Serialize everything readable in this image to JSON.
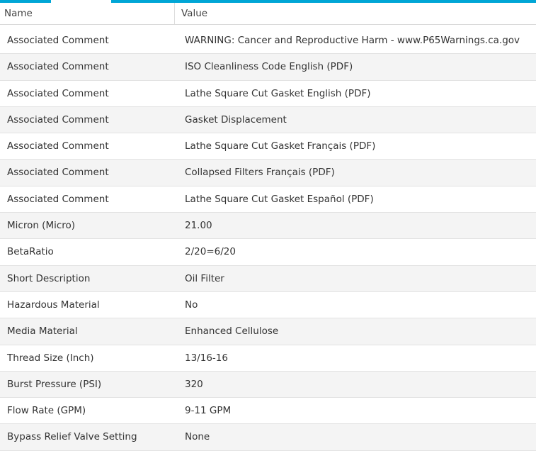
{
  "table": {
    "headers": {
      "name": "Name",
      "value": "Value"
    },
    "rows": [
      {
        "name": "Associated Comment",
        "value": "WARNING: Cancer and Reproductive Harm - www.P65Warnings.ca.gov"
      },
      {
        "name": "Associated Comment",
        "value": "ISO Cleanliness Code English (PDF)"
      },
      {
        "name": "Associated Comment",
        "value": "Lathe Square Cut Gasket English (PDF)"
      },
      {
        "name": "Associated Comment",
        "value": "Gasket Displacement"
      },
      {
        "name": "Associated Comment",
        "value": "Lathe Square Cut Gasket Français (PDF)"
      },
      {
        "name": "Associated Comment",
        "value": "Collapsed Filters Français (PDF)"
      },
      {
        "name": "Associated Comment",
        "value": "Lathe Square Cut Gasket Español (PDF)"
      },
      {
        "name": "Micron (Micro)",
        "value": "21.00"
      },
      {
        "name": "BetaRatio",
        "value": "2/20=6/20"
      },
      {
        "name": "Short Description",
        "value": "Oil Filter"
      },
      {
        "name": "Hazardous Material",
        "value": "No"
      },
      {
        "name": "Media Material",
        "value": "Enhanced Cellulose"
      },
      {
        "name": "Thread Size (Inch)",
        "value": "13/16-16"
      },
      {
        "name": "Burst Pressure (PSI)",
        "value": "320"
      },
      {
        "name": "Flow Rate (GPM)",
        "value": "9-11 GPM"
      },
      {
        "name": "Bypass Relief Valve Setting",
        "value": "None"
      }
    ]
  },
  "colors": {
    "accent": "#00a6d6",
    "row_alt": "#f4f4f4",
    "border": "#e2e2e2"
  }
}
